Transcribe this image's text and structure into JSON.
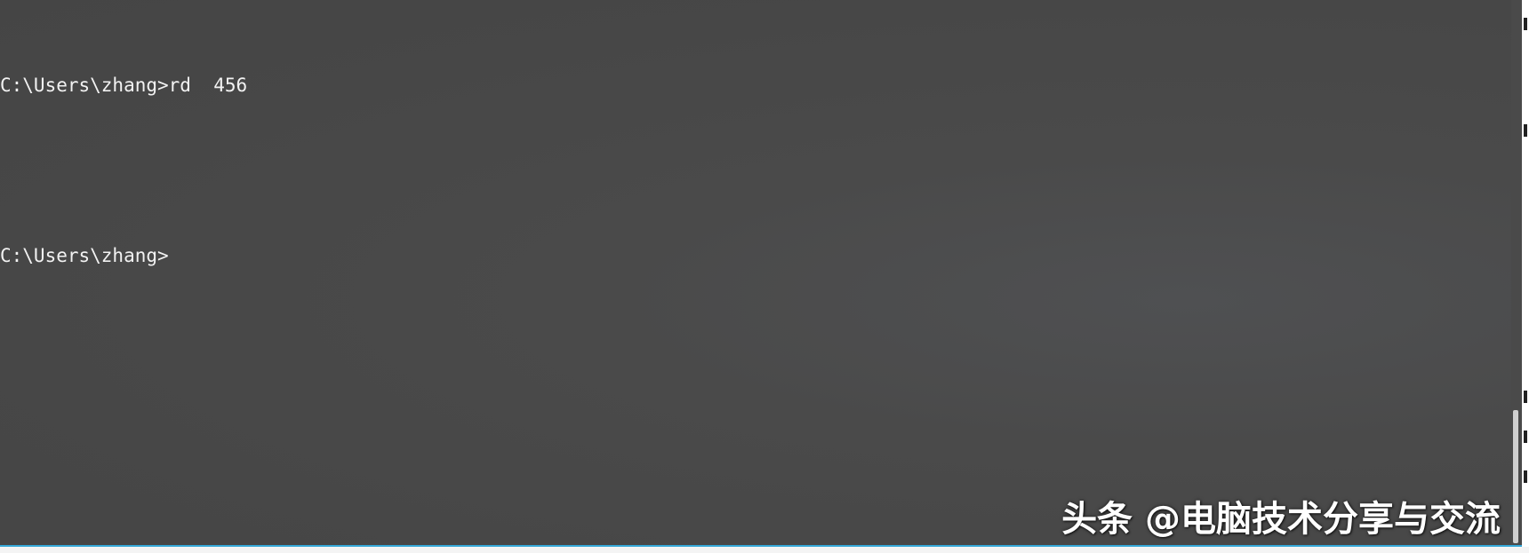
{
  "console": {
    "lines": [
      "C:\\Users\\zhang>rd  456",
      "",
      "C:\\Users\\zhang>"
    ],
    "background_color": "#474747",
    "text_color": "#f2f2f2",
    "accent_border_color": "#35a8d8"
  },
  "watermark": {
    "text": "头条 @电脑技术分享与交流"
  }
}
